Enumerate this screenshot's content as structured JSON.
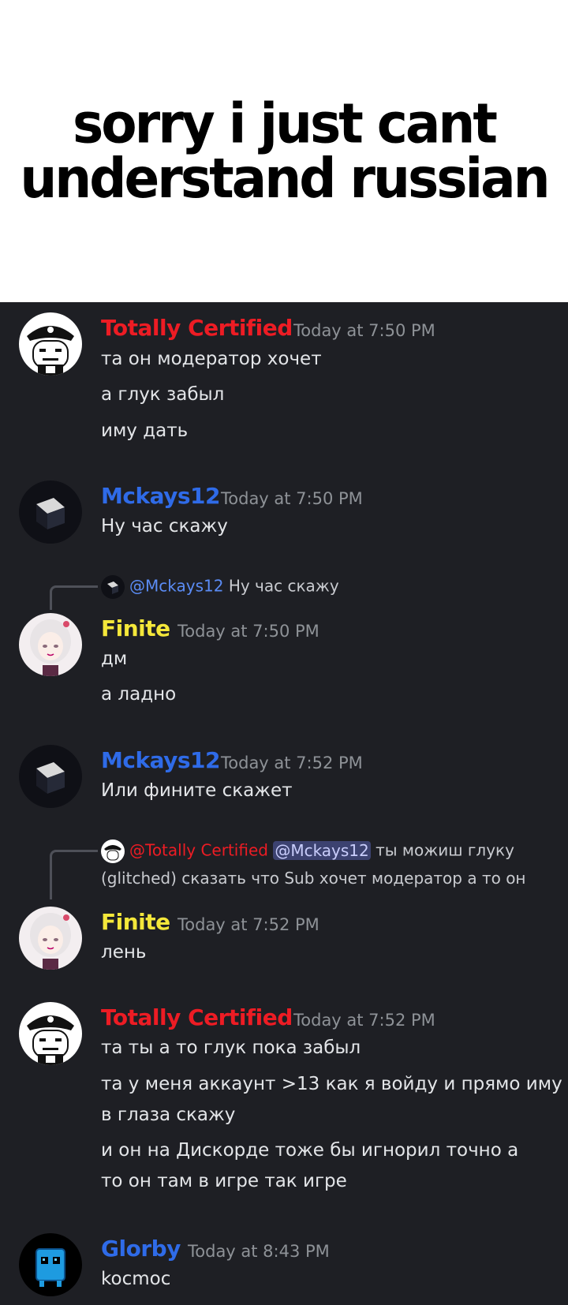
{
  "meme": {
    "caption_line1": "sorry i just cant",
    "caption_line2": "understand russian"
  },
  "colors": {
    "totally_certified": "#ed1c24",
    "mckays12": "#2f6be8",
    "finite": "#f4e73a",
    "glorby": "#2f6be8",
    "background": "#1e1f24"
  },
  "messages": [
    {
      "author": "Totally Certified",
      "time": "Today at 7:50 PM",
      "lines": [
        "та он модератор хочет",
        "а глук забыл",
        "иму дать"
      ]
    },
    {
      "author": "Mckays12",
      "time": "Today at 7:50 PM",
      "lines": [
        "Ну час скажу"
      ]
    },
    {
      "reply": {
        "mention": "@Mckays12",
        "text": "Ну час скажу"
      },
      "author": "Finite",
      "time": "Today at 7:50 PM",
      "lines": [
        "дм",
        "а ладно"
      ]
    },
    {
      "author": "Mckays12",
      "time": "Today at 7:52 PM",
      "lines": [
        "Или фините скажет"
      ]
    },
    {
      "reply": {
        "mention": "@Totally Certified",
        "mention2": "@Mckays12",
        "text1": "ты можиш глуку",
        "text2": "(glitched) сказать что Sub хочет модератор а то он"
      },
      "author": "Finite",
      "time": "Today at 7:52 PM",
      "lines": [
        "лень"
      ]
    },
    {
      "author": "Totally Certified",
      "time": "Today at 7:52 PM",
      "lines": [
        "та ты а то глук пока забыл",
        "та у меня аккаунт >13 как я войду и прямо иму",
        "в глаза скажу",
        "и он на Дискорде  тоже бы игнорил точно а",
        "то он там в игре так игре"
      ]
    },
    {
      "author": "Glorby",
      "time": "Today at 8:43 PM",
      "lines": [
        "kocmoc"
      ]
    }
  ]
}
